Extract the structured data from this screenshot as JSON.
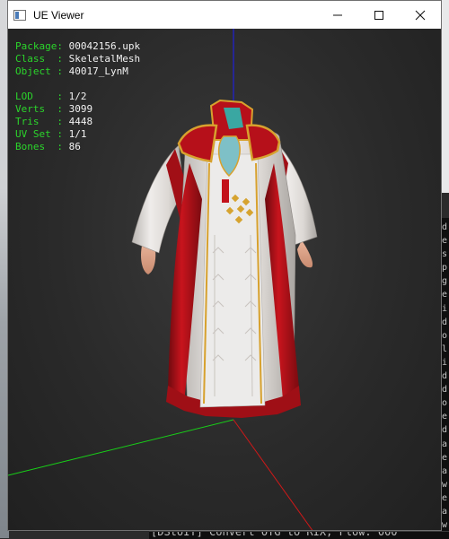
{
  "window": {
    "title": "UE Viewer"
  },
  "hud": {
    "package_label": "Package:",
    "package_value": "00042156.upk",
    "class_label": "Class  :",
    "class_value": "SkeletalMesh",
    "object_label": "Object :",
    "object_value": "40017_LynM",
    "lod_label": "LOD    :",
    "lod_value": "1/2",
    "verts_label": "Verts  :",
    "verts_value": "3099",
    "tris_label": "Tris   :",
    "tris_value": "4448",
    "uvset_label": "UV Set :",
    "uvset_value": "1/1",
    "bones_label": "Bones  :",
    "bones_value": "86"
  },
  "console": {
    "bottom_line": "[DStoIT] Convert OTG to RIX, Flow: 000"
  },
  "colors": {
    "hud_label": "#2bd52b",
    "hud_value": "#f2f2f2",
    "axis_x": "#d01818",
    "axis_y": "#18d018",
    "axis_z": "#2020d8",
    "robe_red": "#b3121a",
    "robe_white": "#e9e6e2",
    "trim_gold": "#d4a12a"
  },
  "icons": {
    "app": "ue-viewer-app-icon",
    "minimize": "minimize-icon",
    "maximize": "maximize-icon",
    "close": "close-icon"
  }
}
